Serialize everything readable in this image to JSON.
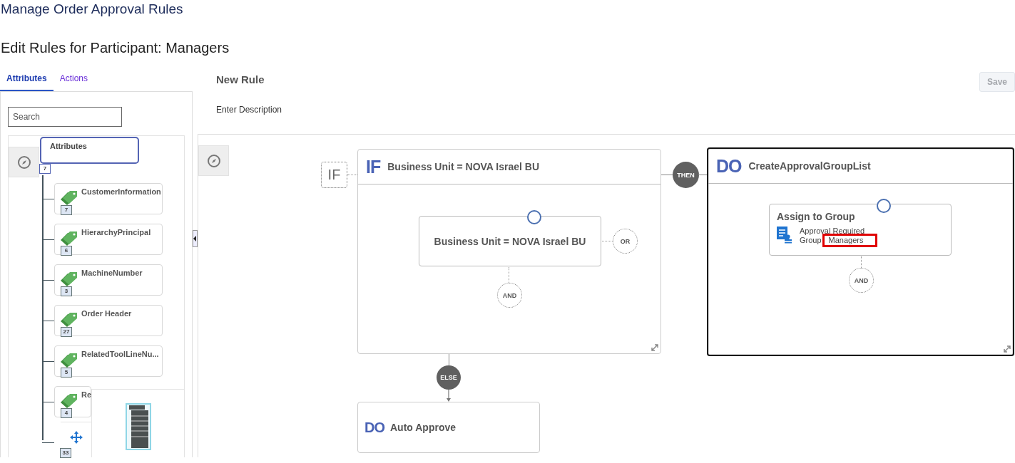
{
  "page_title": "Manage Order Approval Rules",
  "subtitle": "Edit Rules for Participant: Managers",
  "tabs": [
    {
      "label": "Attributes",
      "selected": true
    },
    {
      "label": "Actions",
      "selected": false
    }
  ],
  "search": {
    "placeholder": "Search"
  },
  "tree": {
    "label": "Attributes",
    "count": "7",
    "children": [
      {
        "label": "CustomerInformation",
        "count": "7"
      },
      {
        "label": "HierarchyPrincipal",
        "count": "6"
      },
      {
        "label": "MachineNumber",
        "count": "3"
      },
      {
        "label": "Order Header",
        "count": "27"
      },
      {
        "label": "RelatedToolLineNu...",
        "count": "5"
      },
      {
        "label": "Re",
        "count": "4"
      },
      {
        "count": "33"
      }
    ]
  },
  "rule": {
    "title": "New Rule",
    "description": "Enter Description"
  },
  "save_button": {
    "label": "Save",
    "disabled": true
  },
  "if_block": {
    "tag": "IF",
    "badge": "IF",
    "title": "Business Unit = NOVA Israel BU",
    "condition": "Business Unit = NOVA Israel BU",
    "or": "OR",
    "and": "AND"
  },
  "then": "THEN",
  "do_block": {
    "badge": "DO",
    "title": "CreateApprovalGroupList",
    "selected": true,
    "action": {
      "title": "Assign to Group",
      "line1": "Approval Required",
      "line2": "Group",
      "value": "Managers",
      "highlighted": true
    },
    "and": "AND"
  },
  "else": "ELSE",
  "else_block": {
    "badge": "DO",
    "title": "Auto Approve"
  }
}
